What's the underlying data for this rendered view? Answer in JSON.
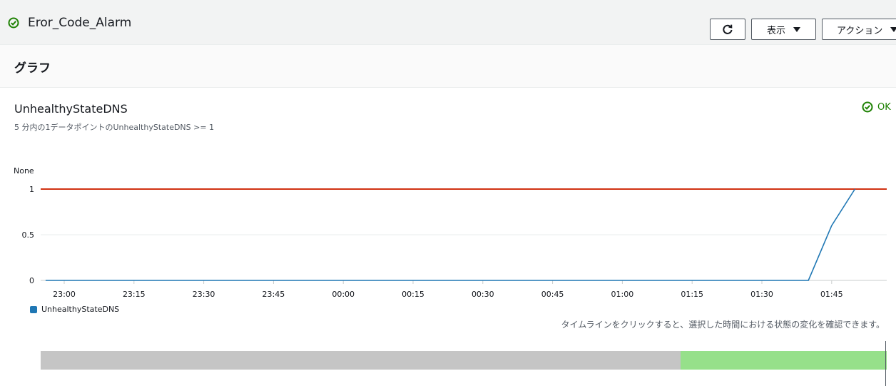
{
  "header": {
    "alarm_name": "Eror_Code_Alarm",
    "view_label": "表示",
    "actions_label": "アクション"
  },
  "section": {
    "title": "グラフ"
  },
  "metric": {
    "name": "UnhealthyStateDNS",
    "description": "5 分内の1データポイントのUnhealthyStateDNS >= 1",
    "state": "OK"
  },
  "chart_data": {
    "type": "line",
    "unit_label": "None",
    "y_ticks": [
      "1",
      "0.5",
      "0"
    ],
    "ylim": [
      0,
      1
    ],
    "x_ticks": [
      "23:00",
      "23:15",
      "23:30",
      "23:45",
      "00:00",
      "00:15",
      "00:30",
      "00:45",
      "01:00",
      "01:15",
      "01:30",
      "01:45"
    ],
    "threshold": 1,
    "threshold_color": "#d13212",
    "series": [
      {
        "name": "UnhealthyStateDNS",
        "color": "#1f77b4",
        "x": [
          "22:56",
          "01:40",
          "01:45",
          "01:50"
        ],
        "y": [
          0,
          0,
          0.6,
          1
        ]
      }
    ]
  },
  "hint": "タイムラインをクリックすると、選択した時間における状態の変化を確認できます。",
  "timeline": {
    "states": [
      "insufficient-data",
      "ok"
    ],
    "colors": [
      "#c5c5c5",
      "#96e08a"
    ]
  }
}
